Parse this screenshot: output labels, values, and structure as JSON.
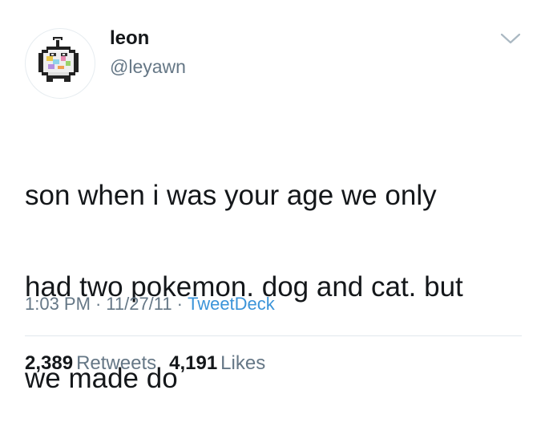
{
  "author": {
    "display_name": "leon",
    "handle": "@leyawn",
    "avatar_icon": "pokemon-avatar-icon"
  },
  "tweet": {
    "text_lines": [
      "son when i was your age we only",
      "had two pokemon. dog and cat. but",
      "we made do"
    ]
  },
  "meta": {
    "time": "1:03 PM",
    "date": "11/27/11",
    "separator": "·",
    "source": "TweetDeck"
  },
  "stats": {
    "retweets_count": "2,389",
    "retweets_label": "Retweets",
    "likes_count": "4,191",
    "likes_label": "Likes"
  },
  "colors": {
    "text_primary": "#14171a",
    "text_secondary": "#657786",
    "link": "#3b94d9",
    "divider": "#e1e8ed"
  }
}
